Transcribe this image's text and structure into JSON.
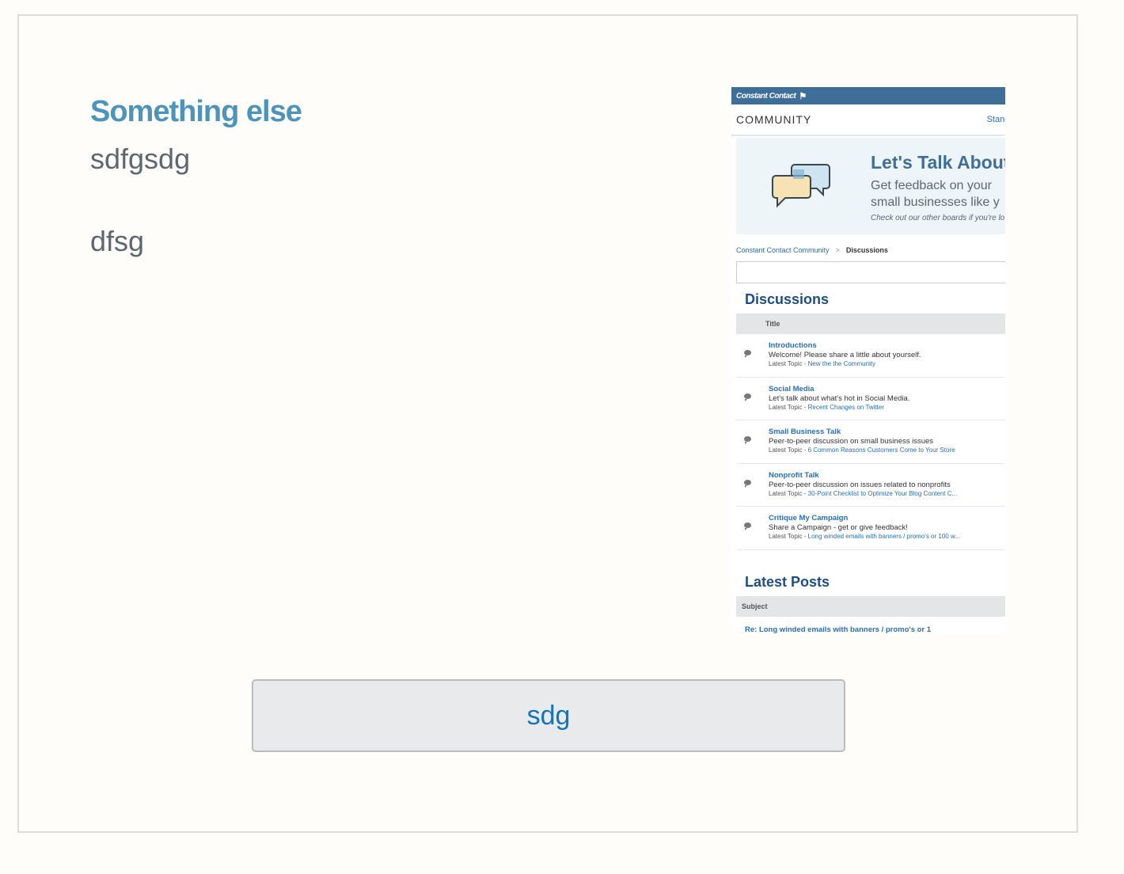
{
  "card": {
    "heading": "Something else",
    "paragraph_1": "sdfgsdg",
    "paragraph_2": "dfsg",
    "button_label": "sdg"
  },
  "screenshot": {
    "brand": "Constant Contact",
    "nav_title": "COMMUNITY",
    "nav_link": "Standalo",
    "banner": {
      "title": "Let's Talk About",
      "line1": "Get feedback on your",
      "line2": "small businesses like y",
      "note": "Check out our other boards if you're lo"
    },
    "breadcrumb": {
      "root": "Constant Contact Community",
      "separator": ">",
      "current": "Discussions"
    },
    "discussions_title": "Discussions",
    "discussions_column": "Title",
    "latest_prefix": "Latest Topic - ",
    "boards": [
      {
        "name": "Introductions",
        "desc": "Welcome! Please share a little about yourself.",
        "latest": "New the the Community"
      },
      {
        "name": "Social Media",
        "desc": "Let's talk about what's hot in Social Media.",
        "latest": "Recent Changes on Twitter"
      },
      {
        "name": "Small Business Talk",
        "desc": "Peer-to-peer discussion on small business issues",
        "latest": "6 Common Reasons Customers Come to Your Store"
      },
      {
        "name": "Nonprofit Talk",
        "desc": "Peer-to-peer discussion on issues related to nonprofits",
        "latest": "30-Point Checklist to Optimize Your Blog Content C..."
      },
      {
        "name": "Critique My Campaign",
        "desc": "Share a Campaign - get or give feedback!",
        "latest": "Long winded emails with banners / promo's or 100 w..."
      }
    ],
    "latest_posts_title": "Latest Posts",
    "latest_posts_column": "Subject",
    "first_post": "Re: Long winded emails with banners / promo's or 1"
  }
}
